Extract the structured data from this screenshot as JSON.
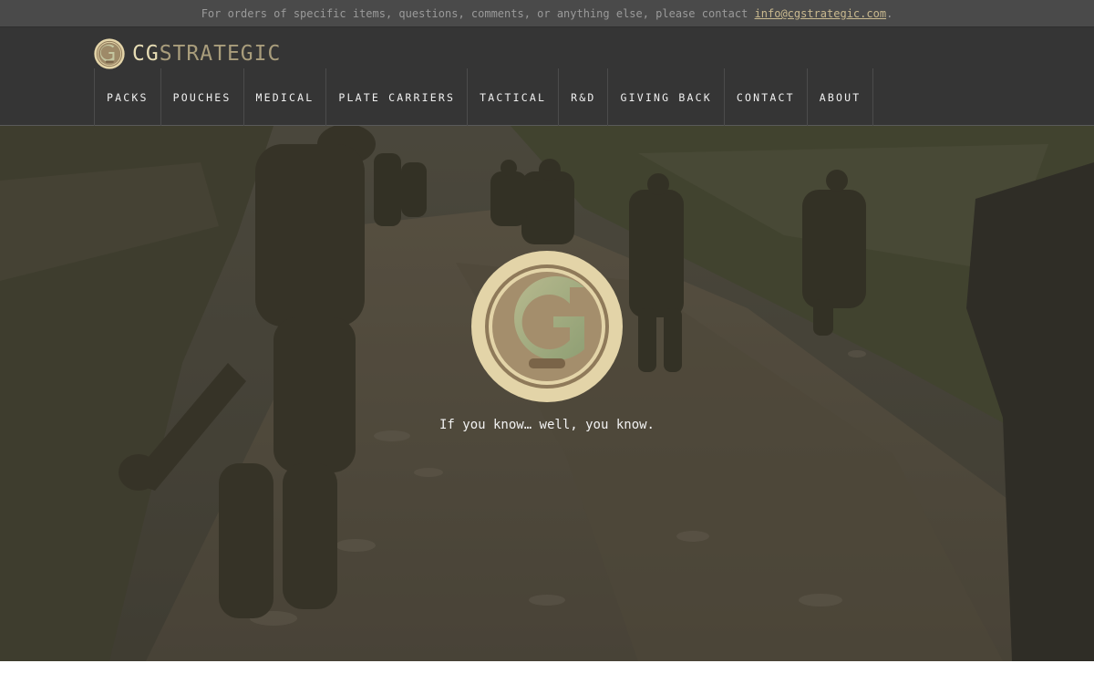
{
  "topbar": {
    "message": "For orders of specific items, questions, comments, or anything else, please contact ",
    "email": "info@cgstrategic.com",
    "suffix": "."
  },
  "brand": {
    "name_part1": "CG",
    "name_part2": "STRATEGIC",
    "logo_icon": "cg-emblem-icon"
  },
  "nav": {
    "items": [
      {
        "label": "PACKS"
      },
      {
        "label": "POUCHES"
      },
      {
        "label": "MEDICAL"
      },
      {
        "label": "PLATE CARRIERS"
      },
      {
        "label": "TACTICAL"
      },
      {
        "label": "R&D"
      },
      {
        "label": "GIVING BACK"
      },
      {
        "label": "CONTACT"
      },
      {
        "label": "ABOUT"
      }
    ]
  },
  "hero": {
    "tagline": "If you know… well, you know.",
    "logo_icon": "cg-emblem-icon",
    "background_description_icon": "soldiers-on-mountain-trail-image"
  },
  "colors": {
    "topbar_bg": "#4a4a4a",
    "header_bg": "#353535",
    "brand_accent": "#e6dcb4",
    "brand_muted": "#a99d7c",
    "emblem_outer": "#e3d4a8",
    "emblem_inner": "#8f7a5a"
  }
}
